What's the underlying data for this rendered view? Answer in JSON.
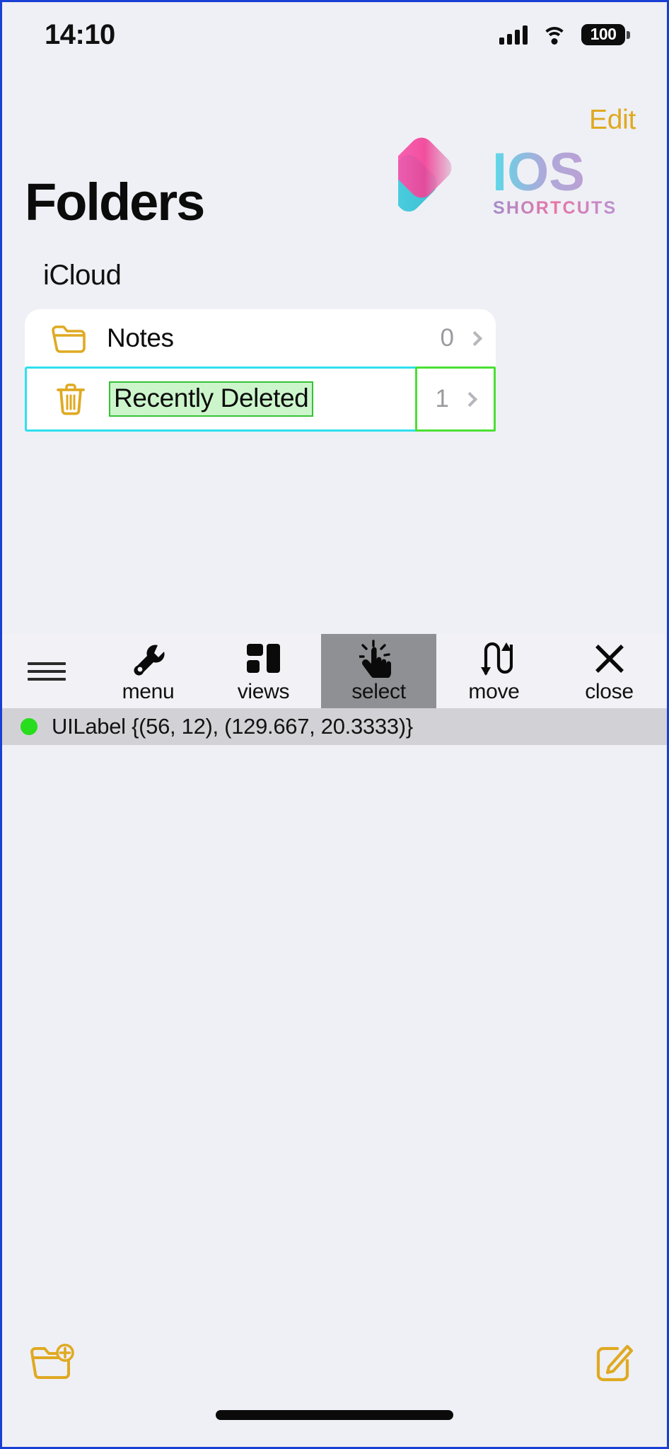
{
  "status_bar": {
    "time": "14:10",
    "signal_icon": "cellular-signal-icon",
    "wifi_icon": "wifi-icon",
    "battery_level": "100"
  },
  "nav": {
    "edit_label": "Edit"
  },
  "watermark": {
    "primary_text": "IOS",
    "secondary_text": "SHORTCUTS",
    "pink": "#f0409a",
    "cyan": "#2cc3d4"
  },
  "header": {
    "title": "Folders",
    "section_label": "iCloud"
  },
  "list": {
    "rows": [
      {
        "icon": "folder-icon",
        "label": "Notes",
        "count": "0",
        "chevron": "chevron-right-icon"
      },
      {
        "icon": "trash-icon",
        "label": "Recently Deleted",
        "count": "1",
        "chevron": "chevron-right-icon"
      }
    ]
  },
  "inspector": {
    "tools": [
      {
        "icon": "hamburger-icon",
        "label": ""
      },
      {
        "icon": "wrench-icon",
        "label": "menu"
      },
      {
        "icon": "views-icon",
        "label": "views"
      },
      {
        "icon": "tap-hand-icon",
        "label": "select"
      },
      {
        "icon": "move-arrows-icon",
        "label": "move"
      },
      {
        "icon": "close-x-icon",
        "label": "close"
      }
    ],
    "active_tool": "select",
    "status_text": "UILabel {(56, 12), (129.667, 20.3333)}",
    "status_dot_color": "#27dd1e"
  },
  "bottom_bar": {
    "new_folder_icon": "new-folder-icon",
    "compose_icon": "compose-icon"
  },
  "colors": {
    "accent_yellow": "#dfa921",
    "highlight_cyan": "#2ee0ef",
    "highlight_green": "#4be033",
    "label_fill_green": "#ccf5cb",
    "page_bg": "#eff0f5",
    "outer_border": "#1a3fd4"
  }
}
